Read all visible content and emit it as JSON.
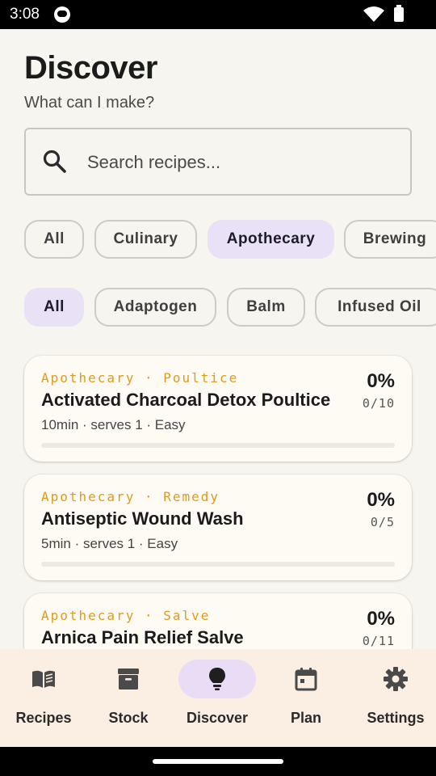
{
  "status_bar": {
    "time": "3:08"
  },
  "header": {
    "title": "Discover",
    "subtitle": "What can I make?"
  },
  "search": {
    "placeholder": "Search recipes..."
  },
  "category_filters": [
    {
      "label": "All",
      "selected": false
    },
    {
      "label": "Culinary",
      "selected": false
    },
    {
      "label": "Apothecary",
      "selected": true
    },
    {
      "label": "Brewing",
      "selected": false
    }
  ],
  "subcategory_filters": [
    {
      "label": "All",
      "selected": true
    },
    {
      "label": "Adaptogen",
      "selected": false
    },
    {
      "label": "Balm",
      "selected": false
    },
    {
      "label": "Infused Oil",
      "selected": false
    }
  ],
  "recipes": [
    {
      "category": "Apothecary · Poultice",
      "title": "Activated Charcoal Detox Poultice",
      "meta": "10min · serves 1 · Easy",
      "percent": "0%",
      "count": "0/10",
      "progress": 0
    },
    {
      "category": "Apothecary · Remedy",
      "title": "Antiseptic Wound Wash",
      "meta": "5min · serves 1 · Easy",
      "percent": "0%",
      "count": "0/5",
      "progress": 0
    },
    {
      "category": "Apothecary · Salve",
      "title": "Arnica Pain Relief Salve",
      "meta": "",
      "percent": "0%",
      "count": "0/11",
      "progress": 0
    }
  ],
  "bottom_nav": [
    {
      "label": "Recipes",
      "icon": "book-icon",
      "active": false
    },
    {
      "label": "Stock",
      "icon": "archive-box-icon",
      "active": false
    },
    {
      "label": "Discover",
      "icon": "lightbulb-icon",
      "active": true
    },
    {
      "label": "Plan",
      "icon": "calendar-icon",
      "active": false
    },
    {
      "label": "Settings",
      "icon": "gear-icon",
      "active": false
    }
  ],
  "colors": {
    "accent": "#e9ddf5",
    "chip_selected": "#e9e1f6",
    "category_text": "#e09a1e",
    "nav_background": "#fbefe3",
    "page_background": "#f7f5ef"
  }
}
